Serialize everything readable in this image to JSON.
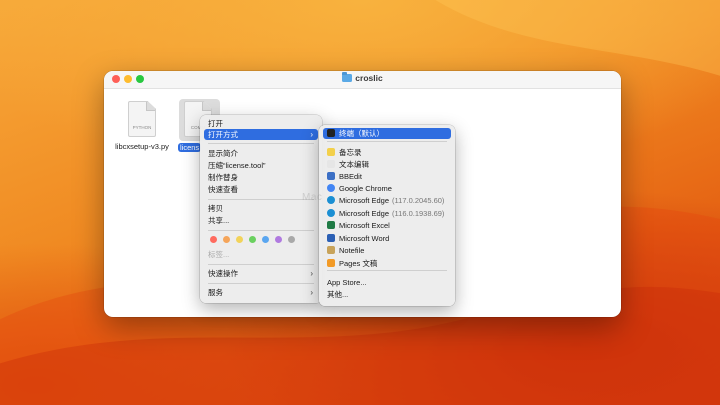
{
  "window": {
    "title": "croslic"
  },
  "files": [
    {
      "name": "libcxsetup-v3.py",
      "type": "PYTHON"
    },
    {
      "name": "license.tool",
      "type": "COMMAND",
      "visible_label": "licens",
      "type_visible": "COMM"
    }
  ],
  "context_menu": {
    "items": [
      {
        "label": "打开"
      },
      {
        "label": "打开方式"
      },
      {
        "label": "显示简介"
      },
      {
        "label": "压缩“license.tool”"
      },
      {
        "label": "制作替身"
      },
      {
        "label": "快速查看"
      },
      {
        "label": "拷贝"
      },
      {
        "label": "共享..."
      },
      {
        "label": "标签..."
      },
      {
        "label": "快速操作"
      },
      {
        "label": "服务"
      }
    ],
    "tag_colors": [
      "#ff6b5f",
      "#f5a55a",
      "#f2d35a",
      "#6ad05f",
      "#5aa6f0",
      "#b07ae0",
      "#a9a9a9"
    ],
    "chevron": "›"
  },
  "submenu": {
    "items": [
      {
        "label": "终端（默认）",
        "icon": "terminal-icon",
        "color": "#222222"
      },
      {
        "label": "备忘录",
        "icon": "notes-icon",
        "color": "#f3d04b"
      },
      {
        "label": "文本编辑",
        "icon": "textedit-icon",
        "color": "#e6e6e6"
      },
      {
        "label": "BBEdit",
        "icon": "bbedit-icon",
        "color": "#3b6fc5"
      },
      {
        "label": "Google Chrome",
        "icon": "chrome-icon",
        "color": "#4285f4"
      },
      {
        "label": "Microsoft Edge",
        "suffix": "(117.0.2045.60)",
        "suffix_visible": "(117.0.2045.60)",
        "icon": "edge-icon",
        "color": "#1b8fd3"
      },
      {
        "label": "Microsoft Edge",
        "suffix": "(116.0.1938.69)",
        "icon": "edge-icon",
        "color": "#1b8fd3"
      },
      {
        "label": "Microsoft Excel",
        "icon": "excel-icon",
        "color": "#1f7a45"
      },
      {
        "label": "Microsoft Word",
        "icon": "word-icon",
        "color": "#2b5fb4"
      },
      {
        "label": "Notefile",
        "icon": "notefile-icon",
        "color": "#c8a35a"
      },
      {
        "label": "Pages 文稿",
        "icon": "pages-icon",
        "color": "#f29a26"
      },
      {
        "label": "App Store..."
      },
      {
        "label": "其他..."
      }
    ]
  },
  "watermark": "Mac"
}
